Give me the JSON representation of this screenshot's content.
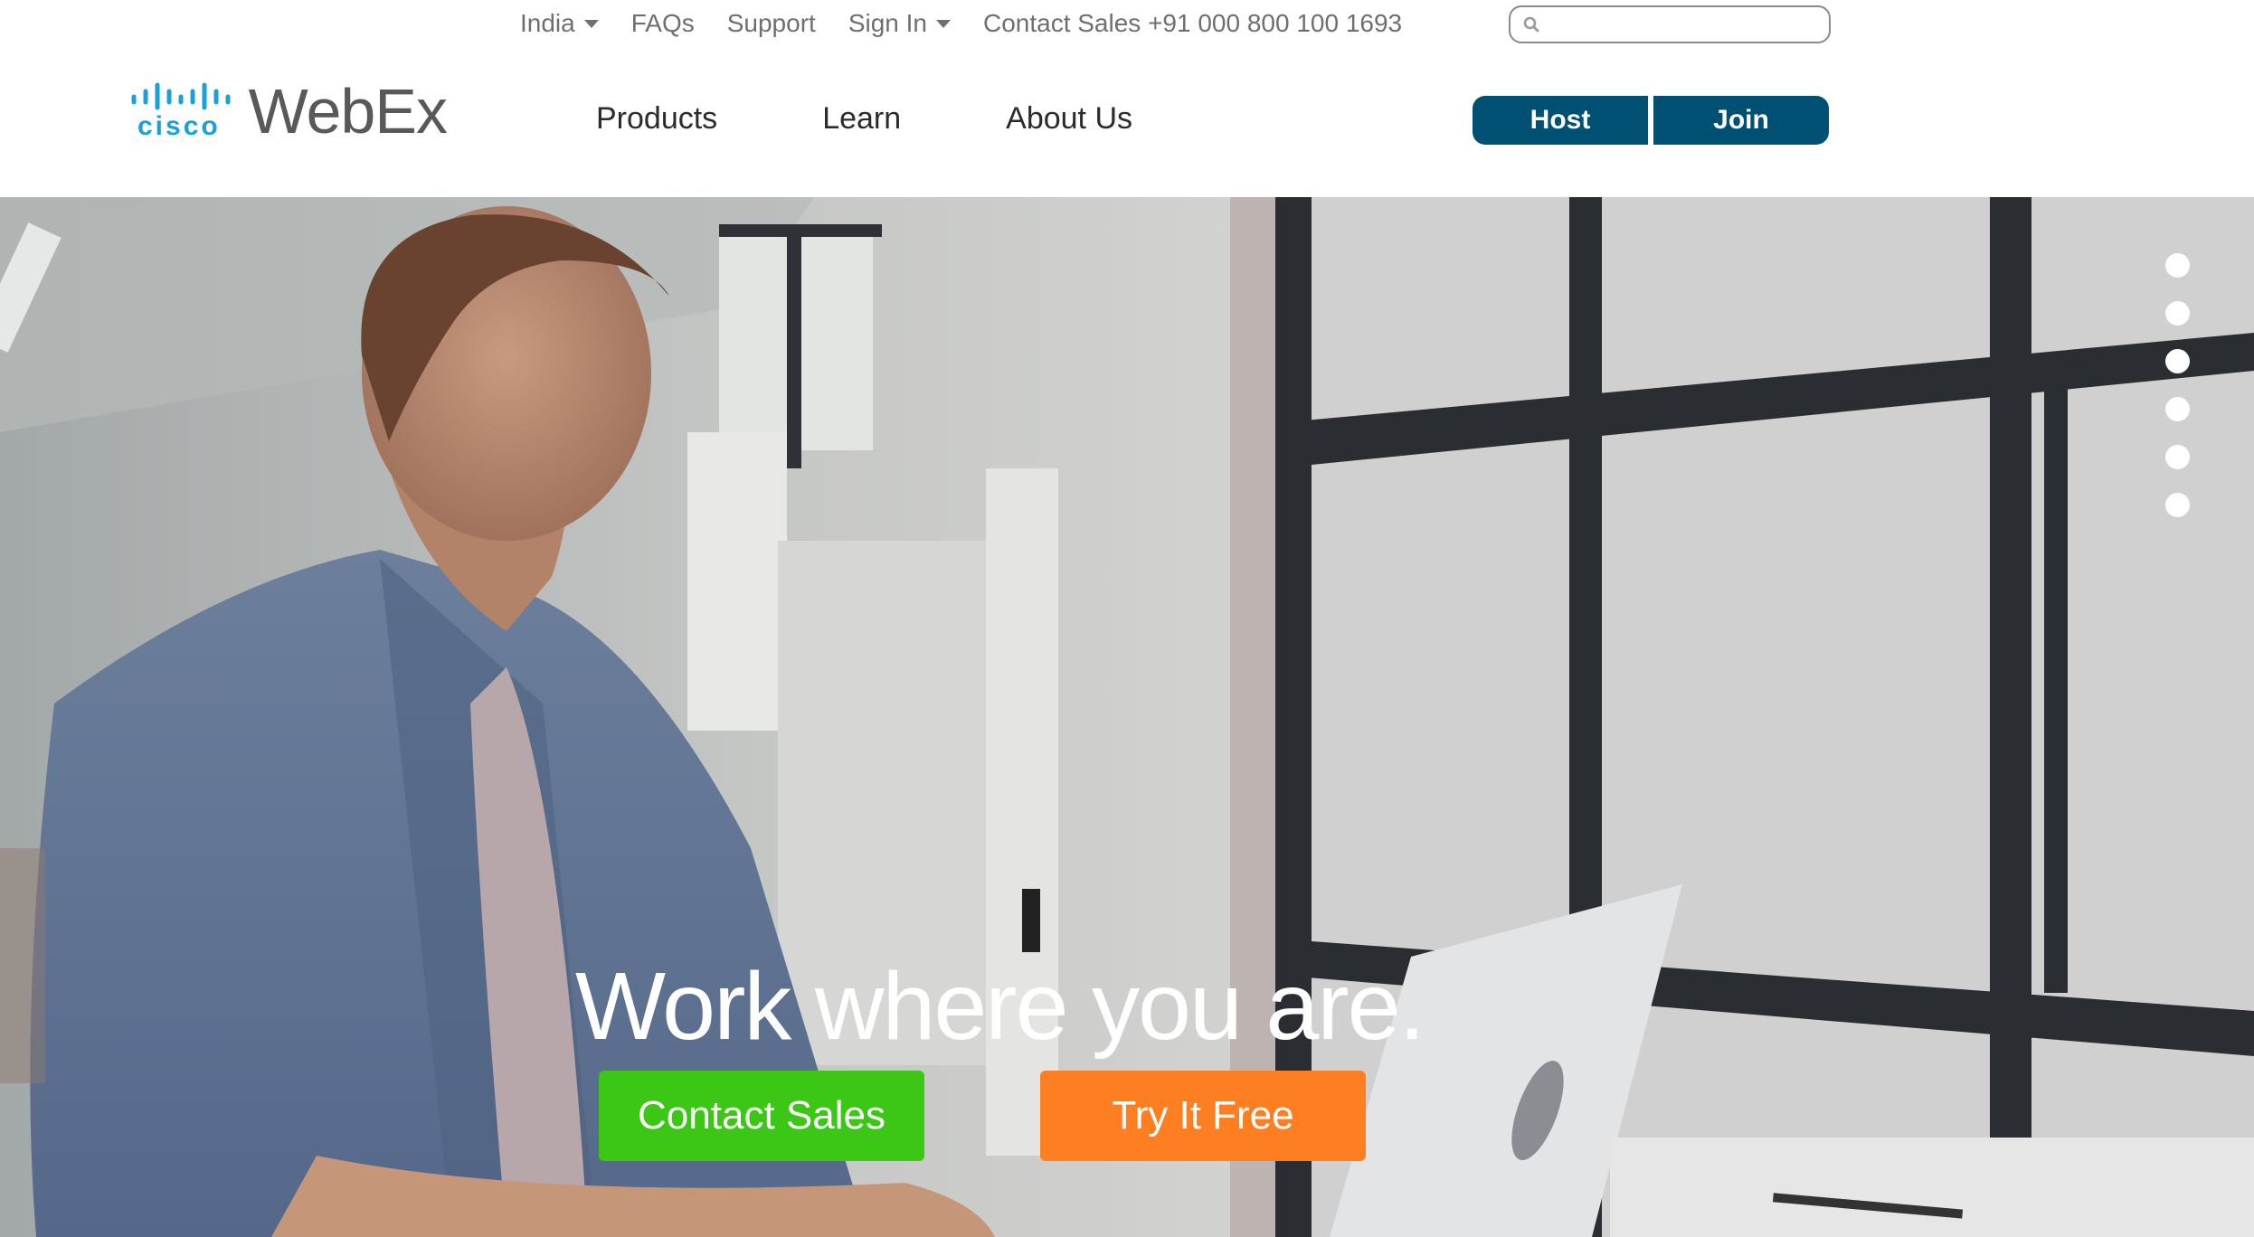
{
  "utility_nav": {
    "items": [
      {
        "label": "India",
        "has_dropdown": true
      },
      {
        "label": "FAQs",
        "has_dropdown": false
      },
      {
        "label": "Support",
        "has_dropdown": false
      },
      {
        "label": "Sign In",
        "has_dropdown": true
      },
      {
        "label": "Contact Sales +91 000 800 100 1693",
        "has_dropdown": false
      }
    ]
  },
  "search": {
    "placeholder": "",
    "value": "",
    "icon": "search-icon"
  },
  "logo": {
    "brand": "cisco",
    "product": "WebEx",
    "brand_color": "#1ba0d7"
  },
  "main_nav": {
    "items": [
      {
        "label": "Products"
      },
      {
        "label": "Learn"
      },
      {
        "label": "About Us"
      }
    ]
  },
  "account_buttons": {
    "host_label": "Host",
    "join_label": "Join",
    "color": "#005073"
  },
  "hero": {
    "headline": "Work where you are.",
    "slide_count": 6,
    "cta_primary": {
      "label": "Contact Sales",
      "color": "#3cc615"
    },
    "cta_secondary": {
      "label": "Try It Free",
      "color": "#fd7f22"
    }
  }
}
